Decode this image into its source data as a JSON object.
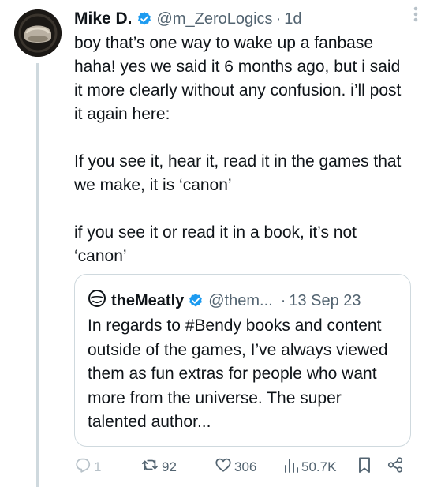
{
  "tweet": {
    "author_name": "Mike D.",
    "handle": "@m_ZeroLogics",
    "separator": "·",
    "time": "1d",
    "paragraphs": [
      "boy that’s one way to wake up a fanbase haha! yes we said it 6 months ago, but i said it more clearly without any confusion. i’ll post it again here:",
      "If you see it, hear it, read it in the games that we make, it is ‘canon’",
      "if you see it or read it in a book, it’s not ‘canon’"
    ]
  },
  "quote": {
    "author_name": "theMeatly",
    "handle": "@them...",
    "separator": "·",
    "date": "13 Sep 23",
    "text": "In regards to #Bendy books and content outside of the games, I’ve always viewed them as fun extras for people who want more from the universe. The super talented author..."
  },
  "actions": {
    "replies": "1",
    "reposts": "92",
    "likes": "306",
    "views": "50.7K"
  },
  "colors": {
    "text": "#0f1419",
    "secondary": "#536471",
    "verified": "#1d9bf0",
    "border": "#cfd9de"
  }
}
